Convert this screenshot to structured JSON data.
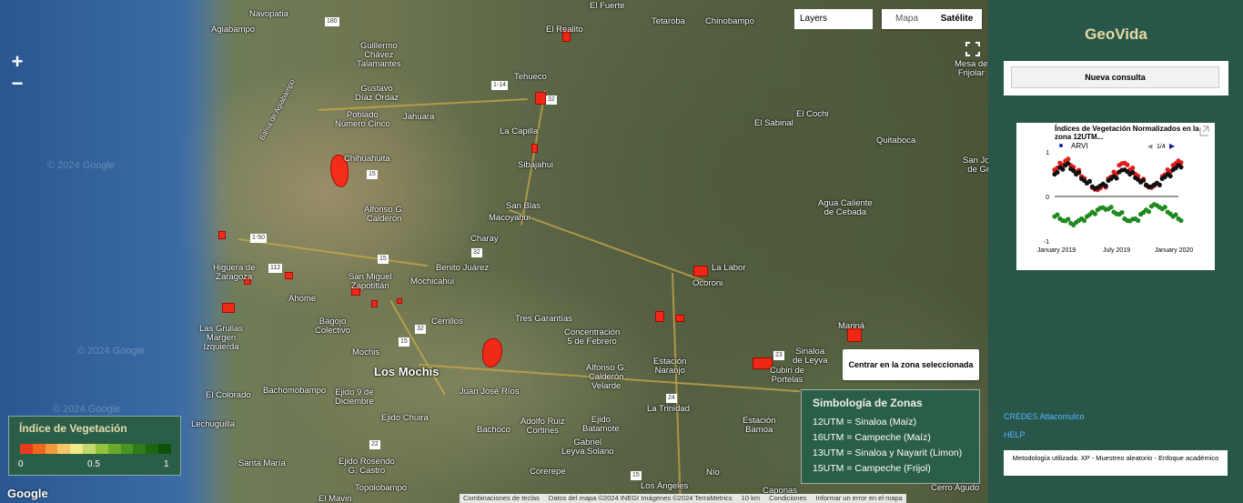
{
  "map": {
    "layers_label": "Layers",
    "map_type": {
      "map": "Mapa",
      "satellite": "Satélite",
      "selected": "satellite"
    },
    "zoom_in": "+",
    "zoom_out": "−",
    "fullscreen_icon": "fullscreen-icon",
    "watermark": "© 2024 Google",
    "places": [
      {
        "name": "Navopatia"
      },
      {
        "name": "Agiabampo"
      },
      {
        "name": "Guillermo\nChávez\nTalamantes"
      },
      {
        "name": "Gustavo\nDíaz Ordaz"
      },
      {
        "name": "Bahía de Agiabampo"
      },
      {
        "name": "Poblado\nNúmero Cinco"
      },
      {
        "name": "Jahuara"
      },
      {
        "name": "El Realito"
      },
      {
        "name": "El Fuerte"
      },
      {
        "name": "Tetaroba"
      },
      {
        "name": "Chinobampo"
      },
      {
        "name": "Tehueco"
      },
      {
        "name": "La Capilla"
      },
      {
        "name": "Sibajahui"
      },
      {
        "name": "Chihuahuita"
      },
      {
        "name": "Alfonso G.\nCalderón"
      },
      {
        "name": "San Blas"
      },
      {
        "name": "Macoyahui"
      },
      {
        "name": "Charay"
      },
      {
        "name": "Benito Juárez"
      },
      {
        "name": "Higuera de\nZaragoza"
      },
      {
        "name": "San Miguel\nZapotitlán"
      },
      {
        "name": "Mochicahui"
      },
      {
        "name": "Ahome"
      },
      {
        "name": "Bagojo\nColectivo"
      },
      {
        "name": "Las Grullas\nMargen\nIzquierda"
      },
      {
        "name": "Cerrillos"
      },
      {
        "name": "Tres Garantías"
      },
      {
        "name": "Concentración\n5 de Febrero"
      },
      {
        "name": "Mochis"
      },
      {
        "name": "Los Mochis"
      },
      {
        "name": "El Colorado"
      },
      {
        "name": "Bachomobampo"
      },
      {
        "name": "Ejido 9 de\nDiciembre"
      },
      {
        "name": "Juan José Ríos"
      },
      {
        "name": "Alfonso G.\nCalderón\nVelarde"
      },
      {
        "name": "Estación\nNaranjo"
      },
      {
        "name": "La Trinidad"
      },
      {
        "name": "Lechuguilla"
      },
      {
        "name": "Ejido Chuira"
      },
      {
        "name": "Bachoco"
      },
      {
        "name": "Adolfo Ruiz\nCortines"
      },
      {
        "name": "Gabriel\nLeyva Solano"
      },
      {
        "name": "Ejido\nBatamote"
      },
      {
        "name": "Santa María"
      },
      {
        "name": "Ejido Rosendo\nG. Castro"
      },
      {
        "name": "Topolobampo"
      },
      {
        "name": "Corerepe"
      },
      {
        "name": "Los Ángeles"
      },
      {
        "name": "Nío"
      },
      {
        "name": "Estación\nBamoa"
      },
      {
        "name": "El Sabinal"
      },
      {
        "name": "El Cochi"
      },
      {
        "name": "Quitaboca"
      },
      {
        "name": "Agua Caliente\nde Cebada"
      },
      {
        "name": "La Labor"
      },
      {
        "name": "Ocoroni"
      },
      {
        "name": "Mariná"
      },
      {
        "name": "Sinaloa\nde Leyva"
      },
      {
        "name": "Cubiri de\nPortelas"
      },
      {
        "name": "Mesa de\nFrijolar"
      },
      {
        "name": "San José\nde Gra"
      },
      {
        "name": "El Maviri"
      },
      {
        "name": "Caponas"
      },
      {
        "name": "Cerro Agudo"
      }
    ],
    "road_labels": [
      "180",
      "1-14",
      "32",
      "15",
      "1-50",
      "112",
      "15",
      "32",
      "32",
      "15",
      "24",
      "23",
      "22",
      "15"
    ],
    "center_button": "Centrar en la zona seleccionada",
    "legend": {
      "title": "Índice de Vegetación",
      "colors": [
        "#e63b1d",
        "#f0681c",
        "#f39a3a",
        "#f5c768",
        "#f3e886",
        "#c4d76b",
        "#93c23d",
        "#6aa92a",
        "#4a9422",
        "#2e7c18",
        "#1b6610",
        "#0e520a"
      ],
      "min_label": "0",
      "mid_label": "0.5",
      "max_label": "1"
    },
    "zone_legend": {
      "title": "Simbología de Zonas",
      "rows": [
        "12UTM = Sinaloa (Maíz)",
        "16UTM = Campeche (Maíz)",
        "13UTM = Sinaloa y Nayarit (Limon)",
        "15UTM = Campeche (Frijol)"
      ]
    },
    "google_logo": "Google",
    "attribution": [
      "Combinaciones de teclas",
      "Datos del mapa ©2024 INEGI Imágenes ©2024 TerraMetrics",
      "10 km",
      "Condiciones",
      "Informar un error en el mapa"
    ]
  },
  "panel": {
    "title": "GeoVida",
    "new_query_button": "Nueva consulta",
    "chart_title": "Índices de Vegetación Normalizados en la zona 12UTM...",
    "chart_legend": "ARVI",
    "chart_pager": "1/4",
    "chart_open_icon": "open-in-new-icon",
    "links": [
      "CREDES Atlacomulco",
      "HELP"
    ],
    "methodology": "Metodología utilizada: XP - Muestreo aleatorio - Enfoque académico"
  },
  "chart_data": {
    "type": "scatter",
    "title": "Índices de Vegetación Normalizados en la zona 12UTM...",
    "x_ticks": [
      "January 2019",
      "July 2019",
      "January 2020"
    ],
    "y_ticks": [
      "1",
      "0",
      "-1"
    ],
    "ylim": [
      -1,
      1
    ],
    "legend": "top-left",
    "series": [
      {
        "name": "ARVI",
        "color": "#1a1aa8",
        "values": []
      },
      {
        "color": "#e21b1b",
        "values": [
          0.6,
          0.75,
          0.8,
          0.7,
          0.55,
          0.45,
          0.3,
          0.2,
          0.15,
          0.25,
          0.4,
          0.55,
          0.7,
          0.75,
          0.6,
          0.5,
          0.35,
          0.25,
          0.2,
          0.3,
          0.45,
          0.6,
          0.7,
          0.8
        ]
      },
      {
        "color": "#111111",
        "values": [
          0.5,
          0.65,
          0.7,
          0.62,
          0.5,
          0.4,
          0.3,
          0.22,
          0.2,
          0.28,
          0.36,
          0.45,
          0.55,
          0.6,
          0.5,
          0.42,
          0.32,
          0.26,
          0.22,
          0.3,
          0.4,
          0.5,
          0.6,
          0.7
        ]
      },
      {
        "color": "#1e8a1e",
        "values": [
          -0.45,
          -0.5,
          -0.55,
          -0.6,
          -0.58,
          -0.5,
          -0.45,
          -0.35,
          -0.3,
          -0.25,
          -0.28,
          -0.35,
          -0.4,
          -0.5,
          -0.55,
          -0.5,
          -0.4,
          -0.3,
          -0.22,
          -0.2,
          -0.28,
          -0.35,
          -0.45,
          -0.5
        ]
      }
    ]
  }
}
